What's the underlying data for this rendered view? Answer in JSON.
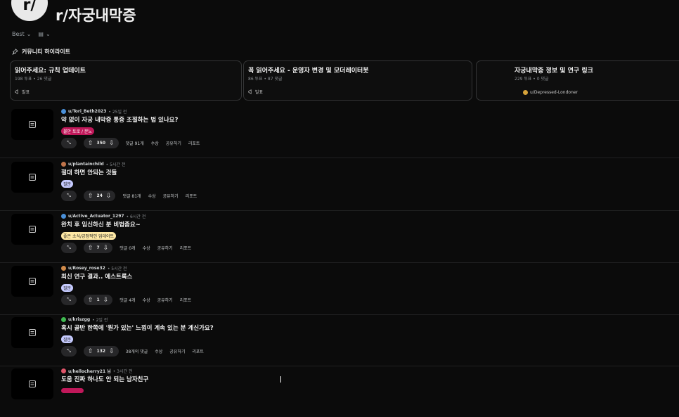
{
  "header": {
    "avatar_text": "r/",
    "subreddit": "r/자궁내막증"
  },
  "sort": {
    "label": "Best",
    "chevron": "⌄",
    "view_icon": "▤",
    "view_chevron": "⌄"
  },
  "highlights": {
    "icon": "pin-icon",
    "title": "커뮤니티 하이라이트"
  },
  "cards": [
    {
      "title": "읽어주세요: 규칙 업데이트",
      "meta": "198 투표 • 26 댓글",
      "footer": "발표"
    },
    {
      "title": "꼭 읽어주세요 - 운영자 변경 및 모더레이터봇",
      "meta": "86 투표 • 87 댓글",
      "footer": "발표"
    },
    {
      "title": "자궁내막증 정보 및 연구 링크",
      "meta": "229 투표 • 0 댓글",
      "footer": "u/Depressed-Londoner"
    }
  ],
  "posts": [
    {
      "user": "u/Tori_Beth2023",
      "time": "• 25일 전",
      "avatar_color": "#4a90d9",
      "title": "약 없이 자궁 내막증 통증 조절하는 법 있나요?",
      "flair": "불안 토로 / 분노",
      "flair_bg": "#c0185a",
      "flair_fg": "#ffffff",
      "score": "350",
      "comments": "댓글 91개",
      "award": "수상",
      "share": "공유하기",
      "report": "리포트"
    },
    {
      "user": "u/plantainchild",
      "time": "• 5시간 전",
      "avatar_color": "#c0744a",
      "title": "절대 하면 안되는 것들",
      "flair": "질문",
      "flair_bg": "#c6cbff",
      "flair_fg": "#1a1a1a",
      "score": "24",
      "comments": "댓글 81개",
      "award": "수상",
      "share": "공유하기",
      "report": "리포트"
    },
    {
      "user": "u/Active_Actuator_1297",
      "time": "• 6시간 전",
      "avatar_color": "#4a90d9",
      "title": "완치 후 임신하신 분 비법좀요~",
      "flair": "좋은 소식/긍정적인 업데이트",
      "flair_bg": "#ffe9a6",
      "flair_fg": "#1a1a1a",
      "score": "7",
      "comments": "댓글 0개",
      "award": "수상",
      "share": "공유하기",
      "report": "리포트"
    },
    {
      "user": "u/Rosey_rose32",
      "time": "• 5시간 전",
      "avatar_color": "#d08a4a",
      "title": "최신 연구 결과.. 에스트록스",
      "flair": "질문",
      "flair_bg": "#c6cbff",
      "flair_fg": "#1a1a1a",
      "score": "1",
      "comments": "댓글 4개",
      "award": "수상",
      "share": "공유하기",
      "report": "리포트"
    },
    {
      "user": "u/kriszgg",
      "time": "• 2일 전",
      "avatar_color": "#3fb950",
      "title": "혹시 골반 한쪽에 '뭔가 있는' 느낌이 계속 있는 분 계신가요?",
      "flair": "질문",
      "flair_bg": "#c6cbff",
      "flair_fg": "#1a1a1a",
      "score": "132",
      "comments": "38개의 댓글",
      "award": "수상",
      "share": "공유하기",
      "report": "리포트"
    },
    {
      "user": "u/hellocherry21 님",
      "time": "• 3시간 전",
      "avatar_color": "#e0556a",
      "title": "도움 진짜 하나도 안 되는 남자친구",
      "flair": "",
      "flair_bg": "#c0185a",
      "flair_fg": "#ffffff",
      "score": "",
      "comments": "",
      "award": "",
      "share": "",
      "report": ""
    }
  ]
}
